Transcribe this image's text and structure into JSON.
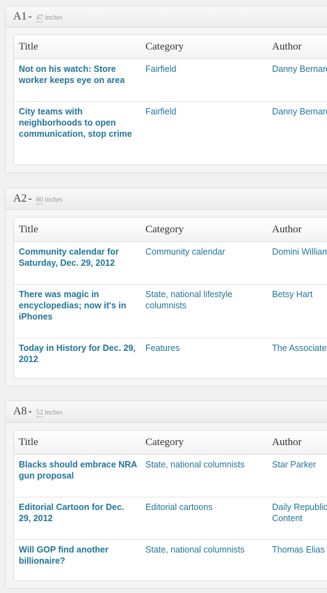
{
  "columns": {
    "title": "Title",
    "category": "Category",
    "author": "Author"
  },
  "sections": [
    {
      "name": "A1",
      "inches": "47",
      "unit": "inches",
      "rows": [
        {
          "title": "Not on his watch: Store worker keeps eye on area",
          "category": "Fairfield",
          "author": "Danny Bernardo"
        },
        {
          "title": "City teams with neighborhoods to open communication, stop crime",
          "category": "Fairfield",
          "author": "Danny Bernardo"
        }
      ]
    },
    {
      "name": "A2",
      "inches": "80",
      "unit": "inches",
      "rows": [
        {
          "title": "Community calendar for Saturday, Dec. 29, 2012",
          "category": "Community calendar",
          "author": "Domini Williams"
        },
        {
          "title": "There was magic in encyclopedias; now it's in iPhones",
          "category": "State, national lifestyle columnists",
          "author": "Betsy Hart"
        },
        {
          "title": "Today in History for Dec. 29, 2012",
          "category": "Features",
          "author": "The Associated Press"
        }
      ]
    },
    {
      "name": "A8",
      "inches": "52",
      "unit": "inches",
      "rows": [
        {
          "title": "Blacks should embrace NRA gun proposal",
          "category": "State, national columnists",
          "author": "Star Parker"
        },
        {
          "title": "Editorial Cartoon for Dec. 29, 2012",
          "category": "Editorial cartoons",
          "author": "Daily Republic Content"
        },
        {
          "title": "Will GOP find another billionaire?",
          "category": "State, national columnists",
          "author": "Thomas Elias"
        }
      ]
    }
  ]
}
